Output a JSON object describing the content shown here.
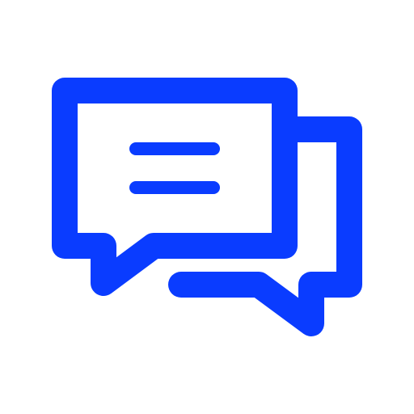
{
  "icon": {
    "name": "chat-bubbles-icon",
    "color": "#0a3cff",
    "background": "#ffffff"
  }
}
